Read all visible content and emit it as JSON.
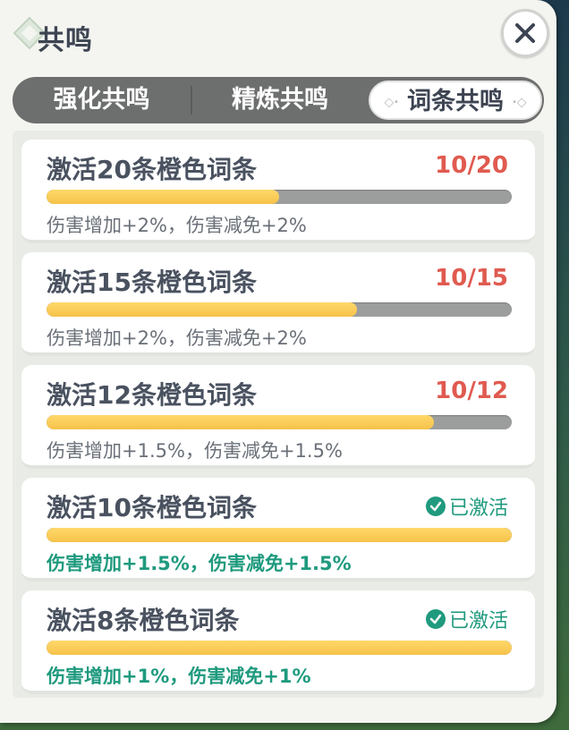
{
  "window": {
    "title": "共鸣"
  },
  "tabs": [
    {
      "label": "强化共鸣",
      "active": false
    },
    {
      "label": "精炼共鸣",
      "active": false
    },
    {
      "label": "词条共鸣",
      "active": true
    }
  ],
  "tiers": [
    {
      "title": "激活20条橙色词条",
      "count": "10/20",
      "progress": 0.5,
      "status": "",
      "effect": "伤害增加+2%，伤害减免+2%",
      "activated": false
    },
    {
      "title": "激活15条橙色词条",
      "count": "10/15",
      "progress": 0.667,
      "status": "",
      "effect": "伤害增加+2%，伤害减免+2%",
      "activated": false
    },
    {
      "title": "激活12条橙色词条",
      "count": "10/12",
      "progress": 0.833,
      "status": "",
      "effect": "伤害增加+1.5%，伤害减免+1.5%",
      "activated": false
    },
    {
      "title": "激活10条橙色词条",
      "count": "",
      "progress": 1.0,
      "status": "已激活",
      "effect": "伤害增加+1.5%，伤害减免+1.5%",
      "activated": true
    },
    {
      "title": "激活8条橙色词条",
      "count": "",
      "progress": 1.0,
      "status": "已激活",
      "effect": "伤害增加+1%，伤害减免+1%",
      "activated": true
    }
  ],
  "colors": {
    "accent_green": "#1f9a7e",
    "count_red": "#e05a4f",
    "bar_fill": "#f6c24a"
  },
  "icons": {
    "close": "close-icon",
    "check": "check-circle-icon",
    "title_ornament": "diamond-ornament-icon"
  }
}
